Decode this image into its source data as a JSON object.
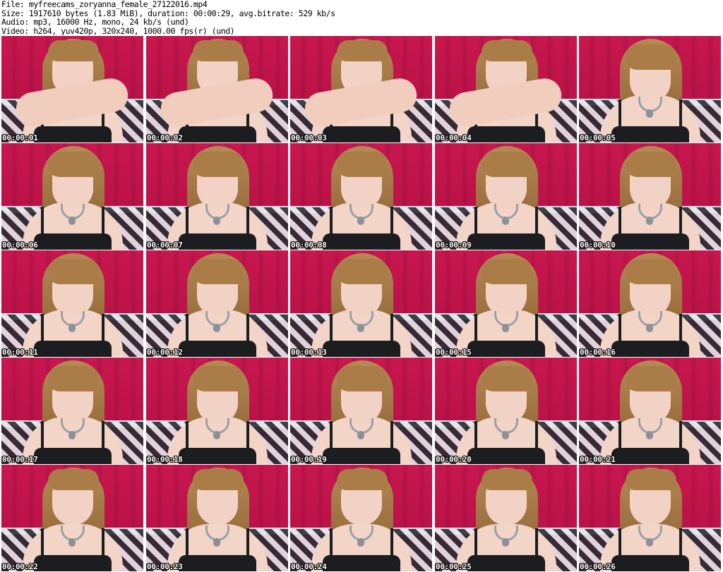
{
  "header": {
    "file_line": "File: myfreecams_zoryanna_female_27122016.mp4",
    "size_line": "Size: 1917610 bytes (1.83 MiB), duration: 00:00:29, avg.bitrate: 529 kb/s",
    "audio_line": "Audio: mp3, 16000 Hz, mono, 24 kb/s (und)",
    "video_line": "Video: h264, yuv420p, 320x240, 1000.00 fps(r) (und)"
  },
  "colors": {
    "background": "#ffffff",
    "curtain": "#c2124a",
    "timestamp_text": "#ffffff",
    "timestamp_outline": "#000000"
  },
  "thumbnails": [
    {
      "timestamp": "00:00:01",
      "pose": "arms"
    },
    {
      "timestamp": "00:00:02",
      "pose": "arms"
    },
    {
      "timestamp": "00:00:03",
      "pose": "arms"
    },
    {
      "timestamp": "00:00:04",
      "pose": "arms"
    },
    {
      "timestamp": "00:00:05",
      "pose": "down"
    },
    {
      "timestamp": "00:00:06",
      "pose": "down"
    },
    {
      "timestamp": "00:00:07",
      "pose": "down"
    },
    {
      "timestamp": "00:00:08",
      "pose": "down"
    },
    {
      "timestamp": "00:00:09",
      "pose": "down"
    },
    {
      "timestamp": "00:00:10",
      "pose": "down"
    },
    {
      "timestamp": "00:00:11",
      "pose": "down"
    },
    {
      "timestamp": "00:00:12",
      "pose": "down"
    },
    {
      "timestamp": "00:00:13",
      "pose": "down"
    },
    {
      "timestamp": "00:00:15",
      "pose": "down"
    },
    {
      "timestamp": "00:00:16",
      "pose": "down"
    },
    {
      "timestamp": "00:00:17",
      "pose": "down"
    },
    {
      "timestamp": "00:00:18",
      "pose": "down"
    },
    {
      "timestamp": "00:00:19",
      "pose": "down"
    },
    {
      "timestamp": "00:00:20",
      "pose": "down"
    },
    {
      "timestamp": "00:00:21",
      "pose": "down"
    },
    {
      "timestamp": "00:00:22",
      "pose": "front"
    },
    {
      "timestamp": "00:00:23",
      "pose": "front"
    },
    {
      "timestamp": "00:00:24",
      "pose": "front"
    },
    {
      "timestamp": "00:00:25",
      "pose": "front"
    },
    {
      "timestamp": "00:00:26",
      "pose": "front"
    }
  ]
}
